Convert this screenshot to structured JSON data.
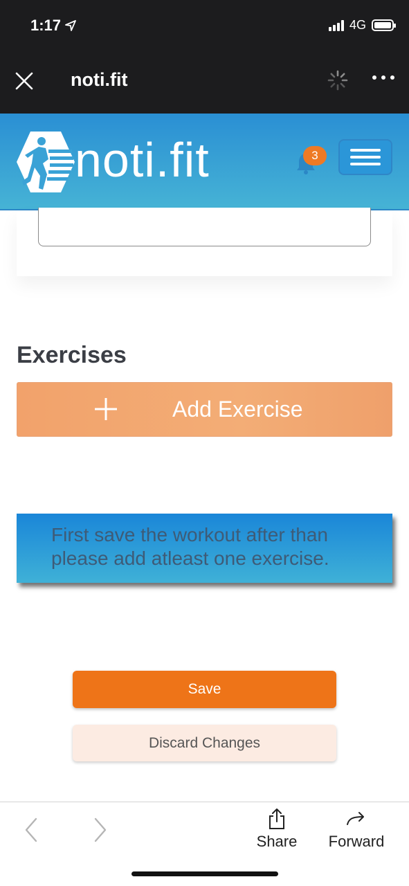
{
  "status_bar": {
    "time": "1:17",
    "network": "4G"
  },
  "webview": {
    "title": "noti.fit"
  },
  "site_header": {
    "logo_text": "noti.fit",
    "notification_count": "3"
  },
  "exercises": {
    "heading": "Exercises",
    "add_button_label": "Add Exercise",
    "notice": "First save the workout after than please add atleast one exercise."
  },
  "actions": {
    "save_label": "Save",
    "discard_label": "Discard Changes"
  },
  "toolbar": {
    "share_label": "Share",
    "forward_label": "Forward"
  },
  "colors": {
    "header_blue": "#2a8fd4",
    "accent_orange": "#ee7418",
    "add_button_orange": "#f2a26b",
    "notice_blue": "#1a86d8"
  }
}
